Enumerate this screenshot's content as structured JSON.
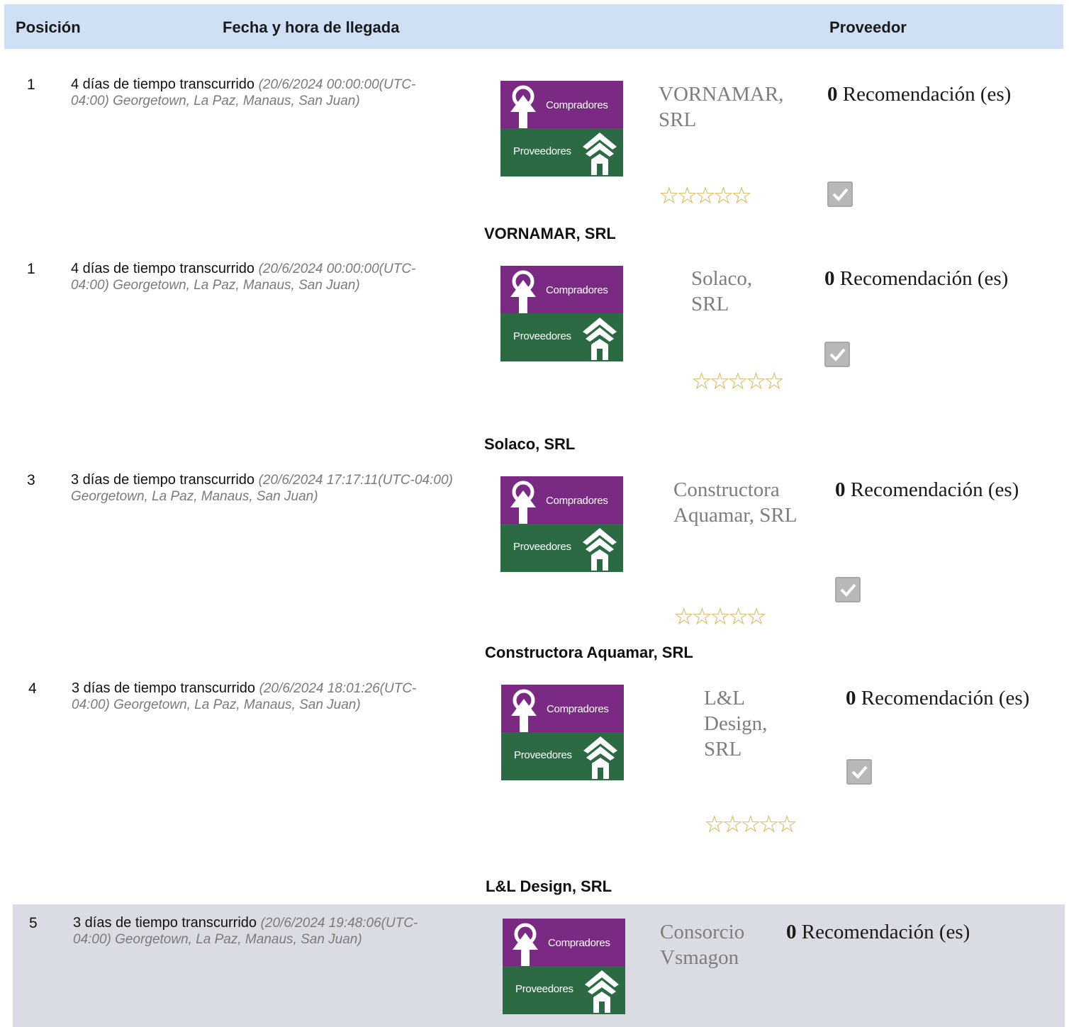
{
  "header": {
    "position": "Posición",
    "arrival": "Fecha y hora de llegada",
    "supplier": "Proveedor"
  },
  "logo": {
    "top_label": "Compradores",
    "bottom_label": "Proveedores"
  },
  "rows": [
    {
      "position": "1",
      "elapsed": "4 días de tiempo transcurrido",
      "datetime": "(20/6/2024 00:00:00(UTC-04:00) Georgetown, La Paz, Manaus, San Juan)",
      "vendor_card": "VORNAMAR, SRL",
      "rec_count": "0",
      "rec_label": "Recomendación (es)",
      "stars": "☆☆☆☆☆",
      "vendor_name": "VORNAMAR, SRL"
    },
    {
      "position": "1",
      "elapsed": "4 días de tiempo transcurrido",
      "datetime": "(20/6/2024 00:00:00(UTC-04:00) Georgetown, La Paz, Manaus, San Juan)",
      "vendor_card": "Solaco, SRL",
      "rec_count": "0",
      "rec_label": "Recomendación (es)",
      "stars": "☆☆☆☆☆",
      "vendor_name": "Solaco, SRL"
    },
    {
      "position": "3",
      "elapsed": "3 días de tiempo transcurrido",
      "datetime": "(20/6/2024 17:17:11(UTC-04:00) Georgetown, La Paz, Manaus, San Juan)",
      "vendor_card": "Constructora Aquamar, SRL",
      "rec_count": "0",
      "rec_label": "Recomendación (es)",
      "stars": "☆☆☆☆☆",
      "vendor_name": "Constructora Aquamar, SRL"
    },
    {
      "position": "4",
      "elapsed": "3 días de tiempo transcurrido",
      "datetime": "(20/6/2024 18:01:26(UTC-04:00) Georgetown, La Paz, Manaus, San Juan)",
      "vendor_card": "L&L Design, SRL",
      "rec_count": "0",
      "rec_label": "Recomendación (es)",
      "stars": "☆☆☆☆☆",
      "vendor_name": "L&L Design, SRL"
    },
    {
      "position": "5",
      "elapsed": "3 días de tiempo transcurrido",
      "datetime": "(20/6/2024 19:48:06(UTC-04:00) Georgetown, La Paz, Manaus, San Juan)",
      "vendor_card": "Consorcio Vsmagon",
      "rec_count": "0",
      "rec_label": "Recomendación (es)"
    }
  ],
  "colors": {
    "header_bg": "#cfe0f5",
    "logo_purple": "#7b2a84",
    "logo_green": "#2c6a43",
    "star": "#d8b24c",
    "shaded_row": "#d9dde3"
  },
  "icons": [
    "logo-icon",
    "star-icon",
    "checkbox-icon"
  ]
}
